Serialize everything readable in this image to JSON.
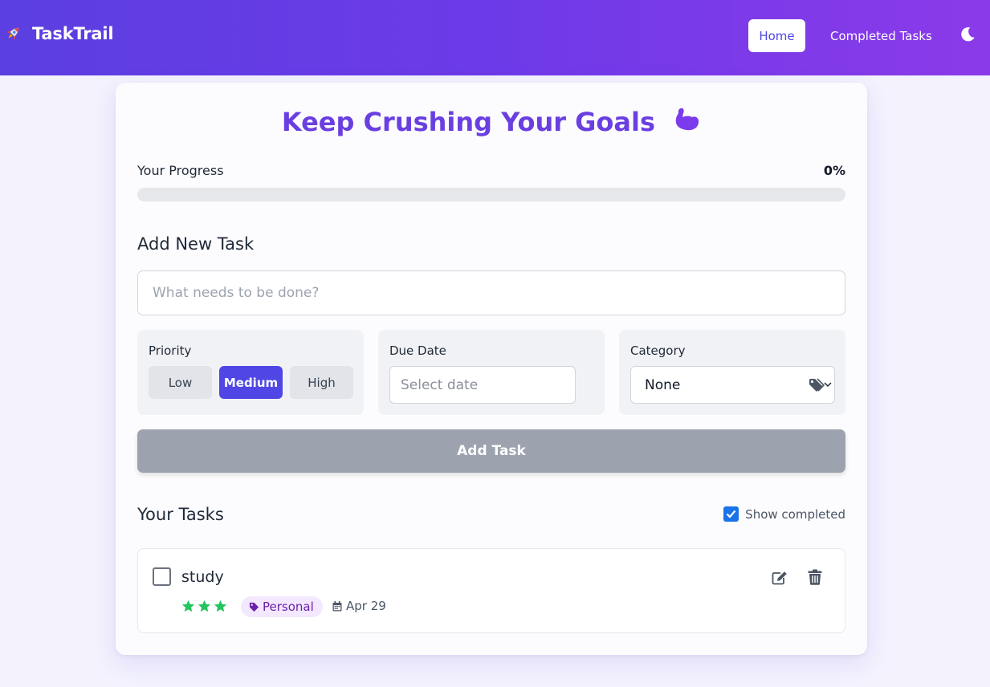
{
  "app": {
    "name": "TaskTrail"
  },
  "nav": {
    "home": "Home",
    "completed": "Completed Tasks"
  },
  "headline": "Keep Crushing Your Goals",
  "progress": {
    "label": "Your Progress",
    "value_text": "0%",
    "fraction": 0
  },
  "add_task": {
    "title": "Add New Task",
    "placeholder": "What needs to be done?",
    "priority_label": "Priority",
    "priorities": [
      "Low",
      "Medium",
      "High"
    ],
    "selected_priority": "Medium",
    "due_label": "Due Date",
    "due_placeholder": "Select date",
    "category_label": "Category",
    "category_value": "None",
    "button": "Add Task"
  },
  "tasks": {
    "title": "Your Tasks",
    "show_completed_label": "Show completed",
    "show_completed": true,
    "items": [
      {
        "name": "study",
        "done": false,
        "stars": 3,
        "tag": "Personal",
        "due": "Apr 29"
      }
    ]
  },
  "colors": {
    "accent": "#4f46e5",
    "header_gradient_start": "#5b3fe0",
    "header_gradient_end": "#8b3ae9",
    "headline": "#6a3fe0",
    "star": "#22c55e",
    "tag_bg": "#f3e8ff",
    "tag_text": "#6b21a8",
    "button_disabled": "#9ca3af"
  },
  "icons": {
    "brand": "rocket-icon",
    "theme": "moon-icon",
    "headline": "flexed-biceps-icon",
    "category": "tag-icon",
    "due": "calendar-icon",
    "edit": "edit-icon",
    "delete": "trash-icon"
  }
}
